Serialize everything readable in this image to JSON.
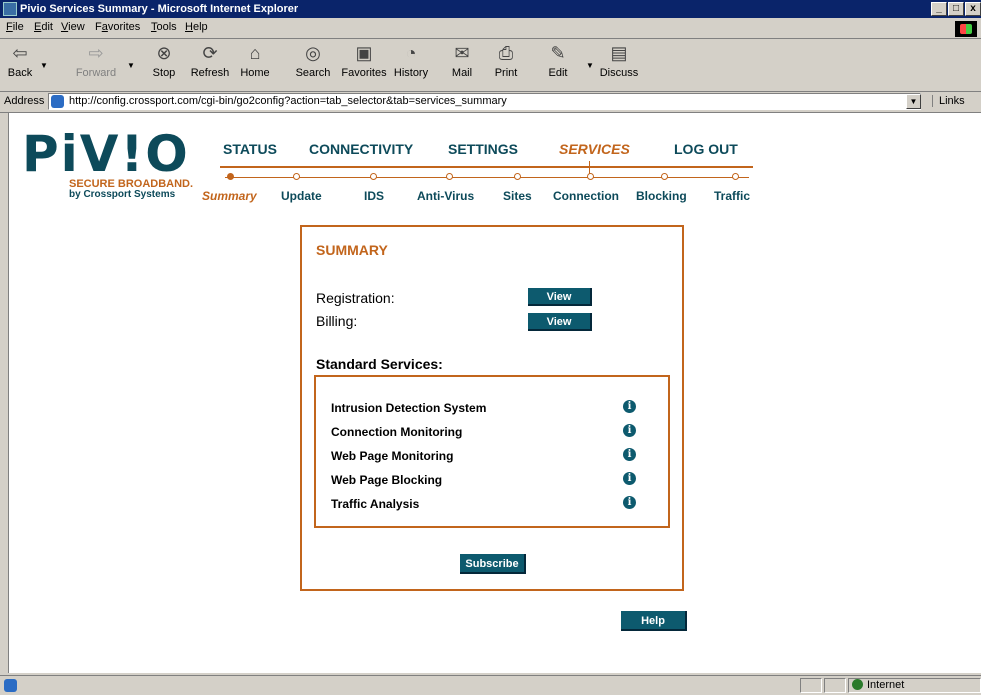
{
  "window": {
    "title": "Pivio Services Summary - Microsoft Internet Explorer",
    "min": "_",
    "max": "□",
    "close": "x"
  },
  "menu": [
    {
      "prefix": "",
      "hot": "F",
      "rest": "ile"
    },
    {
      "prefix": "",
      "hot": "E",
      "rest": "dit"
    },
    {
      "prefix": "",
      "hot": "V",
      "rest": "iew"
    },
    {
      "prefix": "F",
      "hot": "a",
      "rest": "vorites"
    },
    {
      "prefix": "",
      "hot": "T",
      "rest": "ools"
    },
    {
      "prefix": "",
      "hot": "H",
      "rest": "elp"
    }
  ],
  "toolbar": {
    "back": "Back",
    "forward": "Forward",
    "stop": "Stop",
    "refresh": "Refresh",
    "home": "Home",
    "search": "Search",
    "favorites": "Favorites",
    "history": "History",
    "mail": "Mail",
    "print": "Print",
    "edit": "Edit",
    "discuss": "Discuss"
  },
  "address": {
    "label": "Address",
    "url": "http://config.crossport.com/cgi-bin/go2config?action=tab_selector&tab=services_summary",
    "links": "Links"
  },
  "logo": {
    "word": "PiV!O",
    "tagline": "SECURE BROADBAND.",
    "byline": "by Crossport Systems"
  },
  "nav": {
    "status": "STATUS",
    "connectivity": "CONNECTIVITY",
    "settings": "SETTINGS",
    "services": "SERVICES",
    "logout": "LOG OUT"
  },
  "subnav": {
    "summary": "Summary",
    "update": "Update",
    "ids": "IDS",
    "antivirus": "Anti-Virus",
    "sites": "Sites",
    "connection": "Connection",
    "blocking": "Blocking",
    "traffic": "Traffic"
  },
  "summary": {
    "title": "SUMMARY",
    "registration_label": "Registration:",
    "billing_label": "Billing:",
    "view_label": "View",
    "standard_services_title": "Standard Services:",
    "services": [
      "Intrusion Detection System",
      "Connection Monitoring",
      "Web Page Monitoring",
      "Web Page Blocking",
      "Traffic Analysis"
    ],
    "info_glyph": "i",
    "subscribe_label": "Subscribe"
  },
  "help_label": "Help",
  "status": {
    "zone": "Internet"
  },
  "colors": {
    "accent": "#c2651c",
    "brand": "#0d4a5a",
    "button": "#0d5a6e"
  }
}
